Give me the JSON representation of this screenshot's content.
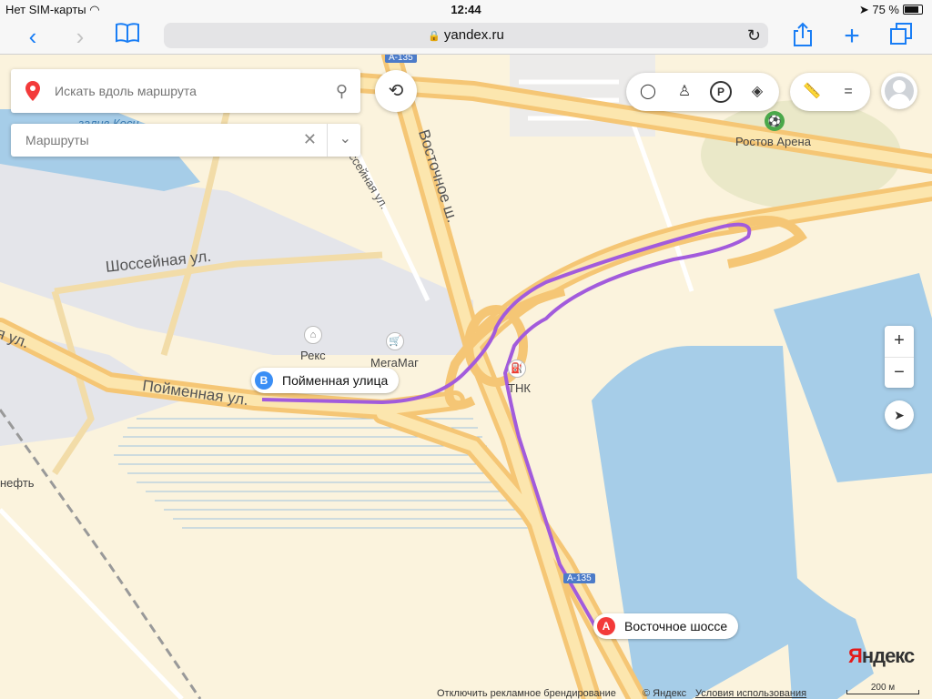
{
  "status_bar": {
    "carrier": "Нет SIM-карты",
    "time": "12:44",
    "battery": "75 %"
  },
  "browser": {
    "url": "yandex.ru"
  },
  "search": {
    "placeholder": "Искать вдоль маршрута"
  },
  "routes": {
    "label": "Маршруты"
  },
  "waypoints": [
    {
      "badge": "A",
      "label": "Восточное шоссе",
      "color": "#f33a3a"
    },
    {
      "badge": "B",
      "label": "Пойменная улица",
      "color": "#3a8ef5"
    }
  ],
  "map_labels": {
    "street_shosseynaya": "Шоссейная ул.",
    "street_shosseynaya_2": "ссейная ул.",
    "street_poymennaya": "Пойменная ул.",
    "street_poymennaya_left": "я ул.",
    "street_vostochnoe": "Восточное ш.",
    "poi_rostov_arena": "Ростов Арена",
    "poi_reks": "Рекс",
    "poi_megamag": "МегаМаг",
    "poi_tnk": "ТНК",
    "poi_neft": "нефть",
    "water_zaliv": "залив Коси",
    "highway_a135": "А-135"
  },
  "footer": {
    "disable_branding": "Отключить рекламное брендирование",
    "copyright": "© Яндекс",
    "terms": "Условия использования",
    "scale": "200 м",
    "brand_first": "Я",
    "brand_rest": "ндекс"
  },
  "colors": {
    "route": "#a25bdc",
    "water": "#a6cde8",
    "major_road": "#f7cf7d",
    "land": "#fbf3dd",
    "industrial": "#e3e4e8"
  }
}
